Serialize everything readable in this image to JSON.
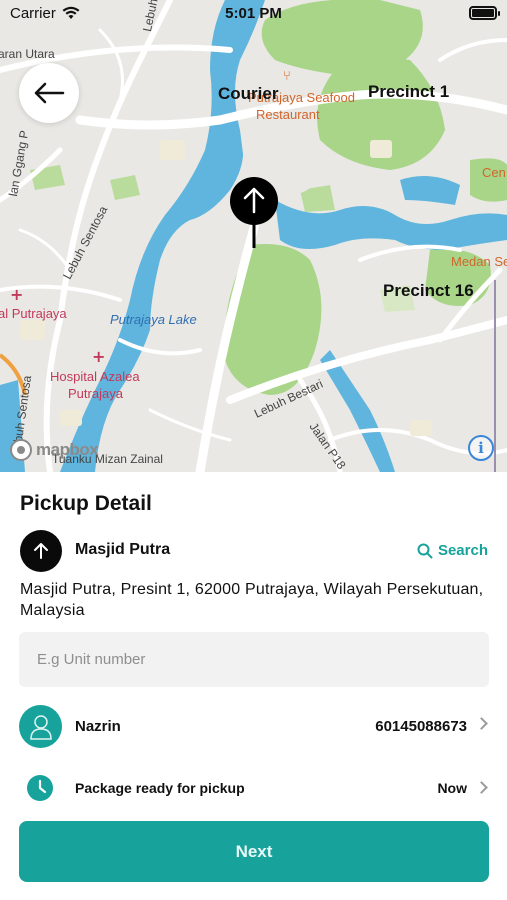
{
  "status_bar": {
    "carrier": "Carrier",
    "time": "5:01 PM"
  },
  "map": {
    "title": "Courier",
    "labels": {
      "precinct_1": "Precinct 1",
      "precinct_16": "Precinct 16",
      "putrajaya_lake": "Putrajaya Lake",
      "seafood": "Putrajaya Seafood",
      "restaurant": "Restaurant",
      "hospital_1": "Hospital Azalea",
      "hospital_2": "Putrajaya",
      "putrajaya_left": "al Putrajaya",
      "lebuh_sentosa_top": "Lebuh Sentosa",
      "lebuh_sentosa_mid": "Lebuh Sentosa",
      "lebuh_sentosa_low": "ebuh Sentosa",
      "lebuh_bestari": "Lebuh Bestari",
      "jalan_p18": "Jalan P18",
      "medan": "Medan Se",
      "cen": "Cen",
      "tuanku": "Tuanku Mizan Zainal",
      "utara": "aran Utara",
      "ggang": "lan Ggang P",
      "mapbox": "mapbox",
      "info": "i"
    },
    "colors": {
      "water": "#5fb5de",
      "park": "#a9d589",
      "land": "#e9e8e4",
      "road": "#ffffff"
    }
  },
  "pickup": {
    "title": "Pickup Detail",
    "location_name": "Masjid Putra",
    "search_label": "Search",
    "address": "Masjid Putra, Presint 1, 62000 Putrajaya, Wilayah Persekutuan, Malaysia",
    "unit_placeholder": "E.g Unit number",
    "unit_value": "",
    "contact_name": "Nazrin",
    "contact_phone": "60145088673",
    "pickup_label": "Package ready for pickup",
    "pickup_time": "Now",
    "next_label": "Next"
  },
  "icons": [
    "wifi-icon",
    "battery-icon",
    "back-arrow-icon",
    "pin-arrow-up-icon",
    "search-icon",
    "user-icon",
    "clock-icon",
    "chevron-right-icon",
    "info-icon"
  ],
  "accent_color": "#17a29b"
}
